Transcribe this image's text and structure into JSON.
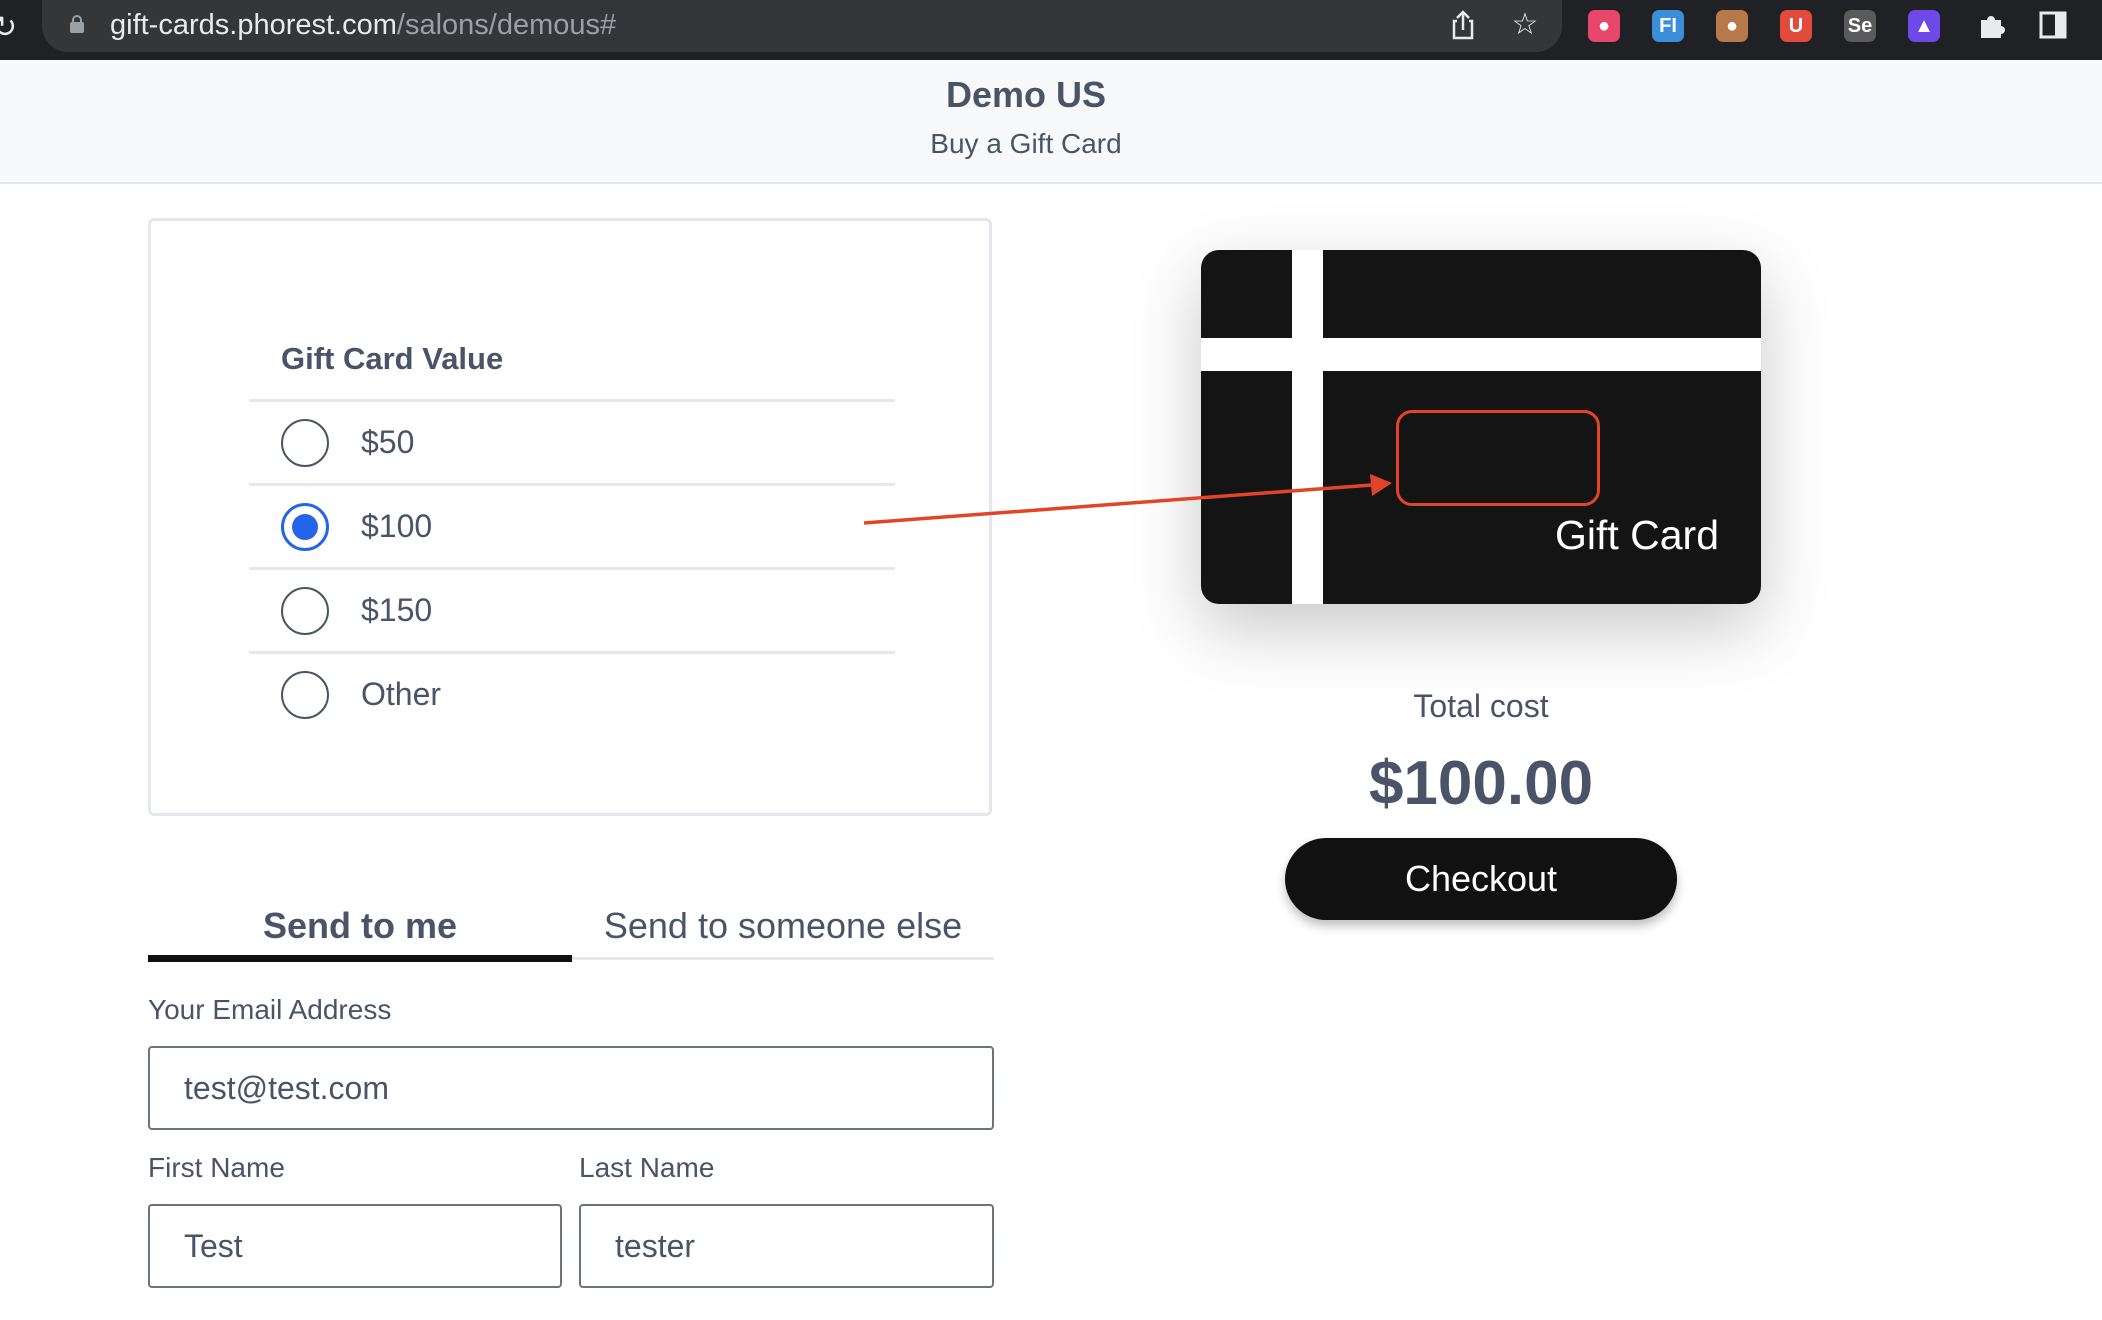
{
  "browser": {
    "url_host": "gift-cards.phorest.com",
    "url_path": "/salons/demous#",
    "extensions": [
      {
        "icon": "strawberry-icon",
        "color": "#e8466b",
        "glyph": "●"
      },
      {
        "icon": "fi-icon",
        "color": "#3b8ed8",
        "glyph": "FI"
      },
      {
        "icon": "cookie-icon",
        "color": "#b7794a",
        "glyph": "●"
      },
      {
        "icon": "magnet-icon",
        "color": "#e14b3b",
        "glyph": "U"
      },
      {
        "icon": "selenium-icon",
        "color": "#5a5a5a",
        "glyph": "Se"
      },
      {
        "icon": "triangle-icon",
        "color": "#6d4ae8",
        "glyph": "▲"
      }
    ]
  },
  "header": {
    "salon_name": "Demo US",
    "subtitle": "Buy a Gift Card"
  },
  "gift_value": {
    "title": "Gift Card Value",
    "options": [
      {
        "label": "$50",
        "selected": false
      },
      {
        "label": "$100",
        "selected": true
      },
      {
        "label": "$150",
        "selected": false
      },
      {
        "label": "Other",
        "selected": false
      }
    ]
  },
  "tabs": {
    "send_to_me": "Send to me",
    "send_to_someone": "Send to someone else",
    "active": "send_to_me"
  },
  "form": {
    "email_label": "Your Email Address",
    "email_value": "test@test.com",
    "first_name_label": "First Name",
    "first_name_value": "Test",
    "last_name_label": "Last Name",
    "last_name_value": "tester"
  },
  "card": {
    "text": "Gift Card"
  },
  "summary": {
    "total_label": "Total cost",
    "total_value": "$100.00",
    "checkout_label": "Checkout"
  },
  "annotation": {
    "color": "#e24427"
  }
}
